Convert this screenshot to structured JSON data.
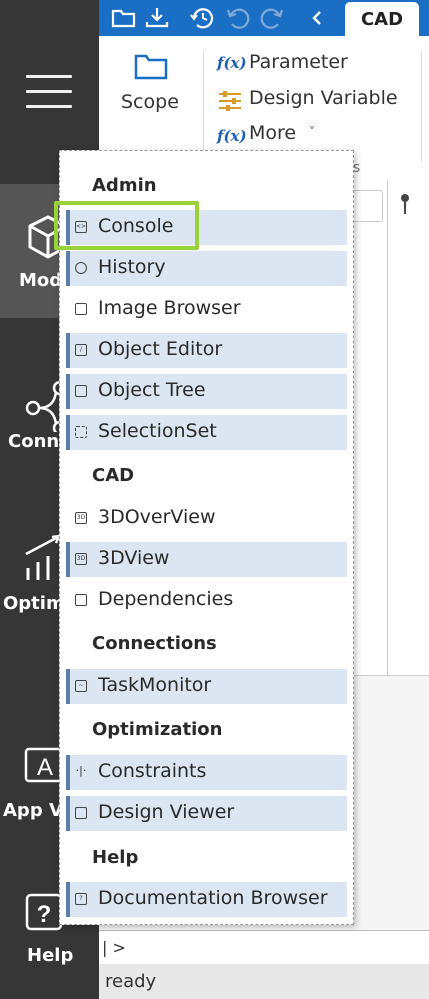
{
  "sidebar": {
    "items": [
      {
        "label": "Mod"
      },
      {
        "label": "Conn"
      },
      {
        "label": "Optim"
      },
      {
        "label": "App V"
      },
      {
        "label": "Help"
      }
    ]
  },
  "topbar": {
    "tab": "CAD"
  },
  "ribbon": {
    "scope": "Scope",
    "fx_symbol": "f(x)",
    "parameter": "Parameter",
    "design_variable": "Design Variable",
    "more": "More",
    "more_caret": "˅",
    "group_fragment": "s"
  },
  "console": {
    "prompt": "| >"
  },
  "status": {
    "text": "ready"
  },
  "menu": {
    "sections": [
      {
        "heading": "Admin",
        "items": [
          "Console",
          "History",
          "Image Browser",
          "Object Editor",
          "Object Tree",
          "SelectionSet"
        ]
      },
      {
        "heading": "CAD",
        "items": [
          "3DOverView",
          "3DView",
          "Dependencies"
        ]
      },
      {
        "heading": "Connections",
        "items": [
          "TaskMonitor"
        ]
      },
      {
        "heading": "Optimization",
        "items": [
          "Constraints",
          "Design Viewer"
        ]
      },
      {
        "heading": "Help",
        "items": [
          "Documentation Browser"
        ]
      }
    ]
  },
  "icons": {
    "folder": "folder-icon",
    "download": "download-icon",
    "history": "history-icon",
    "undo": "undo-icon",
    "redo": "redo-icon",
    "back": "chevron-left-icon"
  },
  "colors": {
    "topbar": "#1a6fc4",
    "sidebar": "#363636",
    "highlight": "#dbe6f2",
    "focus": "#9ad23a"
  }
}
